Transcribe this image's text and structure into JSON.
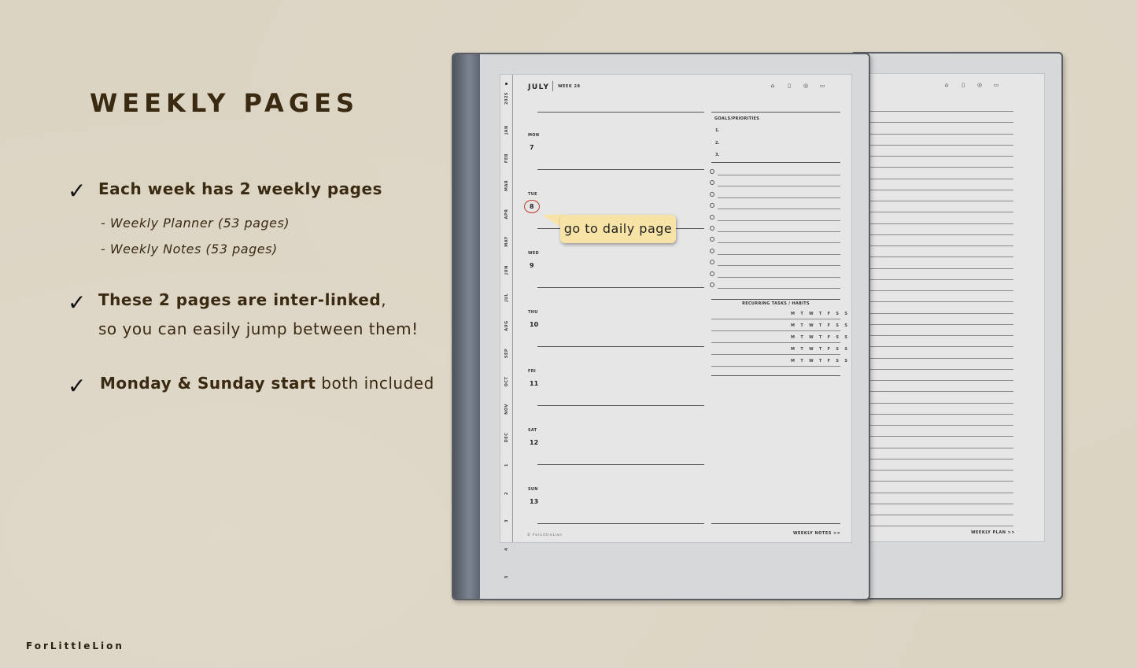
{
  "heading": "WEEKLY PAGES",
  "features": [
    {
      "check": "✓",
      "bold": "Each week has 2 weekly pages",
      "rest": ""
    },
    {
      "check": "✓",
      "bold": "These 2 pages are inter-linked",
      "rest": ","
    },
    {
      "check": "✓",
      "bold": "Monday & Sunday start",
      "rest": " both included"
    }
  ],
  "feature1_subs": [
    "- Weekly Planner (53 pages)",
    "- Weekly Notes (53 pages)"
  ],
  "feature2_line2": "so you can easily jump between them!",
  "brand": "ForLittleLion",
  "callout": "go to daily page",
  "planner": {
    "year": "2025",
    "month": "JULY",
    "week": "WEEK 28",
    "tabs": [
      "JAN",
      "FEB",
      "MAR",
      "APR",
      "MAY",
      "JUN",
      "JUL",
      "AUG",
      "SEP",
      "OCT",
      "NOV",
      "DEC",
      "1",
      "2",
      "3",
      "4",
      "5"
    ],
    "days": [
      {
        "name": "MON",
        "num": "7"
      },
      {
        "name": "TUE",
        "num": "8"
      },
      {
        "name": "WED",
        "num": "9"
      },
      {
        "name": "THU",
        "num": "10"
      },
      {
        "name": "FRI",
        "num": "11"
      },
      {
        "name": "SAT",
        "num": "12"
      },
      {
        "name": "SUN",
        "num": "13"
      }
    ],
    "goals_heading": "GOALS/PRIORITIES",
    "goal_numbers": [
      "1.",
      "2.",
      "3."
    ],
    "recurring_heading": "RECURRING TASKS / HABITS",
    "weekday_letters": "M T W T F S S",
    "copyright": "© ForLittleLion",
    "front_link": "WEEKLY NOTES >>",
    "back_link": "WEEKLY PLAN >>",
    "icons": [
      "home-icon",
      "page-icon",
      "check-circle-icon",
      "briefcase-icon"
    ]
  }
}
